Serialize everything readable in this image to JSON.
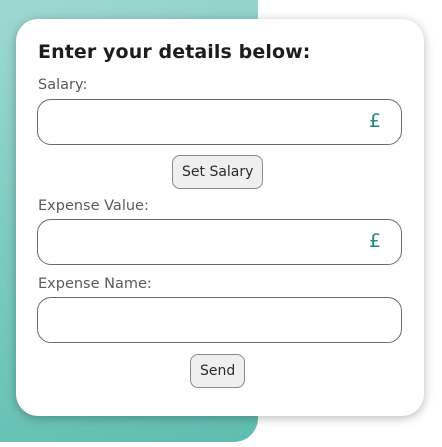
{
  "form": {
    "title": "Enter your details below:",
    "salary": {
      "label": "Salary:",
      "value": "",
      "currency": "£"
    },
    "set_salary_button": "Set Salary",
    "expense_value": {
      "label": "Expense Value:",
      "value": "",
      "currency": "£"
    },
    "expense_name": {
      "label": "Expense Name:",
      "value": ""
    },
    "send_button": "Send"
  },
  "colors": {
    "accent": "#1f8a7a",
    "background_gradient": "#7dcbc1"
  }
}
